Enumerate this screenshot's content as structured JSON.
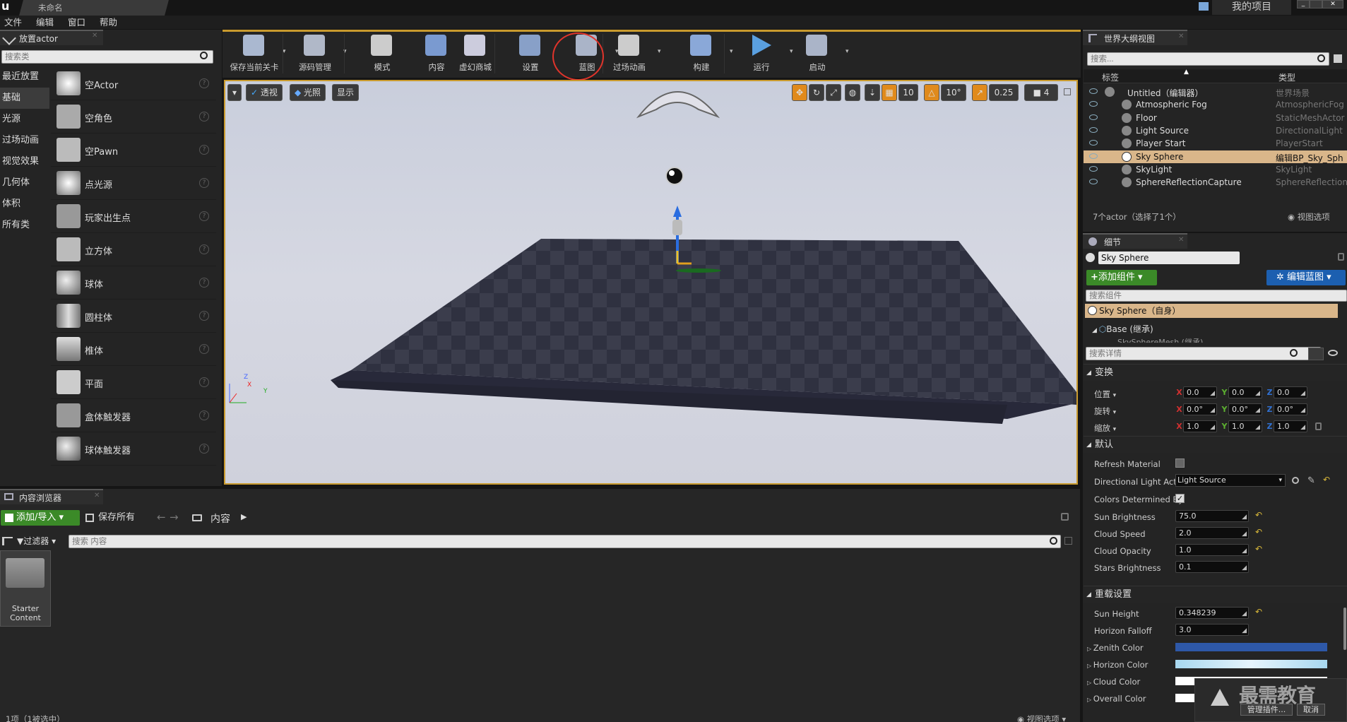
{
  "app": {
    "logo": "u",
    "tab_title": "未命名",
    "project_name": "我的项目"
  },
  "menu": [
    "文件",
    "编辑",
    "窗口",
    "帮助"
  ],
  "modes": {
    "tab": "放置actor",
    "search_placeholder": "搜索类",
    "categories": [
      "最近放置",
      "基础",
      "光源",
      "过场动画",
      "视觉效果",
      "几何体",
      "体积",
      "所有类"
    ],
    "selected_category": "基础",
    "actors": [
      "空Actor",
      "空角色",
      "空Pawn",
      "点光源",
      "玩家出生点",
      "立方体",
      "球体",
      "圆柱体",
      "椎体",
      "平面",
      "盒体触发器",
      "球体触发器"
    ]
  },
  "toolbar": {
    "buttons": [
      {
        "label": "保存当前关卡",
        "icon": "save-icon"
      },
      {
        "label": "源码管理",
        "icon": "source-control-icon"
      },
      {
        "label": "模式",
        "icon": "modes-icon"
      },
      {
        "label": "内容",
        "icon": "content-icon"
      },
      {
        "label": "虚幻商城",
        "icon": "marketplace-icon"
      },
      {
        "label": "设置",
        "icon": "settings-icon"
      },
      {
        "label": "蓝图",
        "icon": "blueprint-icon"
      },
      {
        "label": "过场动画",
        "icon": "cinematics-icon"
      },
      {
        "label": "构建",
        "icon": "build-icon"
      },
      {
        "label": "运行",
        "icon": "play-icon"
      },
      {
        "label": "启动",
        "icon": "launch-icon"
      }
    ],
    "highlighted": "蓝图",
    "highlight_color": "#e0342b"
  },
  "viewport": {
    "perspective": "透视",
    "lit": "光照",
    "show": "显示",
    "grid": "10",
    "rotation": "10°",
    "scale": "0.25",
    "camera_speed": "4",
    "axis": {
      "x": "X",
      "y": "Y",
      "z": "Z"
    }
  },
  "outliner": {
    "tab": "世界大纲视图",
    "search_placeholder": "搜索...",
    "col_label": "标签",
    "col_type": "类型",
    "rows": [
      {
        "name": "Untitled（编辑器）",
        "type": "世界场景"
      },
      {
        "name": "Atmospheric Fog",
        "type": "AtmosphericFog"
      },
      {
        "name": "Floor",
        "type": "StaticMeshActor"
      },
      {
        "name": "Light Source",
        "type": "DirectionalLight"
      },
      {
        "name": "Player Start",
        "type": "PlayerStart"
      },
      {
        "name": "Sky Sphere",
        "type": "编辑BP_Sky_Sph"
      },
      {
        "name": "SkyLight",
        "type": "SkyLight"
      },
      {
        "name": "SphereReflectionCapture",
        "type": "SphereReflectionC"
      }
    ],
    "selected": "Sky Sphere",
    "status": "7个actor（选择了1个）",
    "view_options": "视图选项"
  },
  "details": {
    "tab": "细节",
    "name": "Sky Sphere",
    "add_component": "添加组件",
    "edit_blueprint": "编辑蓝图",
    "search_components": "搜索组件",
    "self_item": "Sky Sphere（自身）",
    "base_item": "Base (继承)",
    "mesh_item": "SkySphereMesh (继承)",
    "search_details": "搜索详情",
    "transform": {
      "title": "变换",
      "location": {
        "label": "位置",
        "x": "0.0",
        "y": "0.0",
        "z": "0.0"
      },
      "rotation": {
        "label": "旋转",
        "x": "0.0°",
        "y": "0.0°",
        "z": "0.0°"
      },
      "scale": {
        "label": "缩放",
        "x": "1.0",
        "y": "1.0",
        "z": "1.0"
      }
    },
    "default": {
      "title": "默认",
      "refresh": "Refresh Material",
      "dir_light_label": "Directional Light Actor",
      "dir_light": "Light Source",
      "colors_label": "Colors Determined By",
      "sun_brightness_label": "Sun Brightness",
      "sun_brightness": "75.0",
      "cloud_speed_label": "Cloud Speed",
      "cloud_speed": "2.0",
      "cloud_opacity_label": "Cloud Opacity",
      "cloud_opacity": "1.0",
      "stars_label": "Stars Brightness",
      "stars": "0.1"
    },
    "override": {
      "title": "重载设置",
      "sun_height_label": "Sun Height",
      "sun_height": "0.348239",
      "horizon_falloff_label": "Horizon Falloff",
      "horizon_falloff": "3.0",
      "zenith_label": "Zenith Color",
      "horizon_color_label": "Horizon Color",
      "cloud_color_label": "Cloud Color",
      "overall_label": "Overall Color"
    },
    "colors": {
      "zenith": "#2e58a8",
      "horizon": "#a8d8f0",
      "cloud": "#ffffff",
      "overall": "#ffffff"
    }
  },
  "content": {
    "tab": "内容浏览器",
    "add_import": "添加/导入",
    "save_all": "保存所有",
    "path": "内容",
    "filters": "过滤器",
    "search_placeholder": "搜索 内容",
    "folder": "Starter Content",
    "status": "1项（1被选中）",
    "view_options": "视图选项"
  },
  "notification": {
    "manage": "管理插件...",
    "cancel": "取消",
    "watermark": "最需教育"
  }
}
